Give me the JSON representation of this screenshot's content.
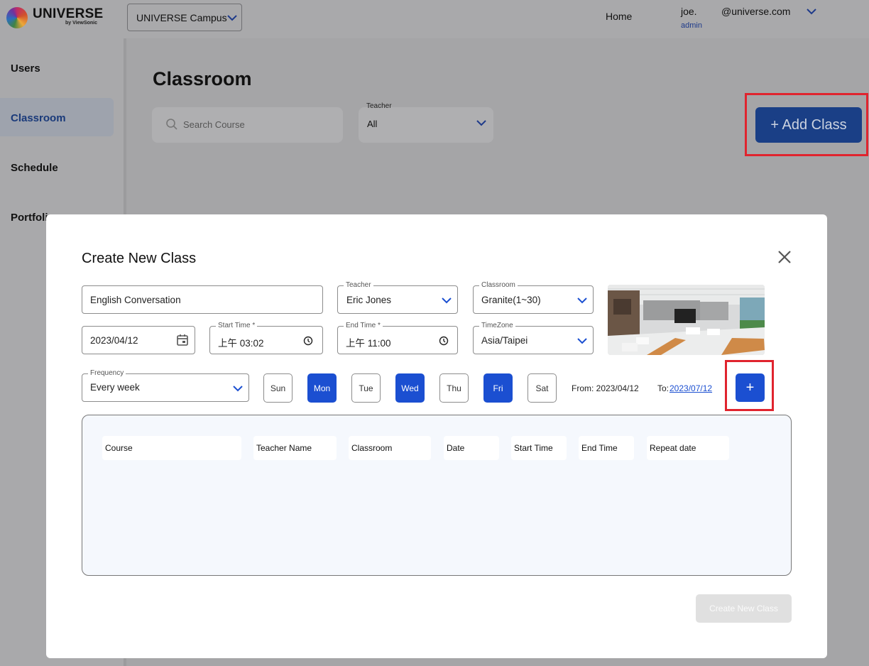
{
  "header": {
    "logo_text": "UNIVERSE",
    "logo_sub": "by ViewSonic",
    "campus": "UNIVERSE Campus",
    "home_link": "Home",
    "user_name": "joe.",
    "user_email": "@universe.com",
    "user_role": "admin"
  },
  "sidebar": {
    "items": [
      {
        "label": "Users"
      },
      {
        "label": "Classroom",
        "active": true
      },
      {
        "label": "Schedule"
      },
      {
        "label": "Portfolio"
      }
    ]
  },
  "main": {
    "title": "Classroom",
    "search_placeholder": "Search Course",
    "teacher_filter_label": "Teacher",
    "teacher_filter_value": "All",
    "add_button": "+ Add Class"
  },
  "modal": {
    "title": "Create New Class",
    "course_name": "English Conversation",
    "teacher": {
      "label": "Teacher",
      "value": "Eric Jones"
    },
    "classroom": {
      "label": "Classroom",
      "value": "Granite(1~30)"
    },
    "date": "2023/04/12",
    "start_time": {
      "label": "Start Time *",
      "value": "上午 03:02"
    },
    "end_time": {
      "label": "End Time *",
      "value": "上午 11:00"
    },
    "timezone": {
      "label": "TimeZone",
      "value": "Asia/Taipei"
    },
    "frequency": {
      "label": "Frequency",
      "value": "Every week"
    },
    "days": [
      {
        "label": "Sun",
        "selected": false
      },
      {
        "label": "Mon",
        "selected": true
      },
      {
        "label": "Tue",
        "selected": false
      },
      {
        "label": "Wed",
        "selected": true
      },
      {
        "label": "Thu",
        "selected": false
      },
      {
        "label": "Fri",
        "selected": true
      },
      {
        "label": "Sat",
        "selected": false
      }
    ],
    "from_text": "From: 2023/04/12",
    "to_label": "To:",
    "to_date": "2023/07/12",
    "add_schedule_button": "+",
    "table_headers": [
      "Course",
      "Teacher Name",
      "Classroom",
      "Date",
      "Start Time",
      "End Time",
      "Repeat date"
    ],
    "submit_button": "Create New Class"
  },
  "colors": {
    "accent": "#1b4fd1",
    "highlight": "#e0242e",
    "overlay": "#a5a5a7"
  }
}
